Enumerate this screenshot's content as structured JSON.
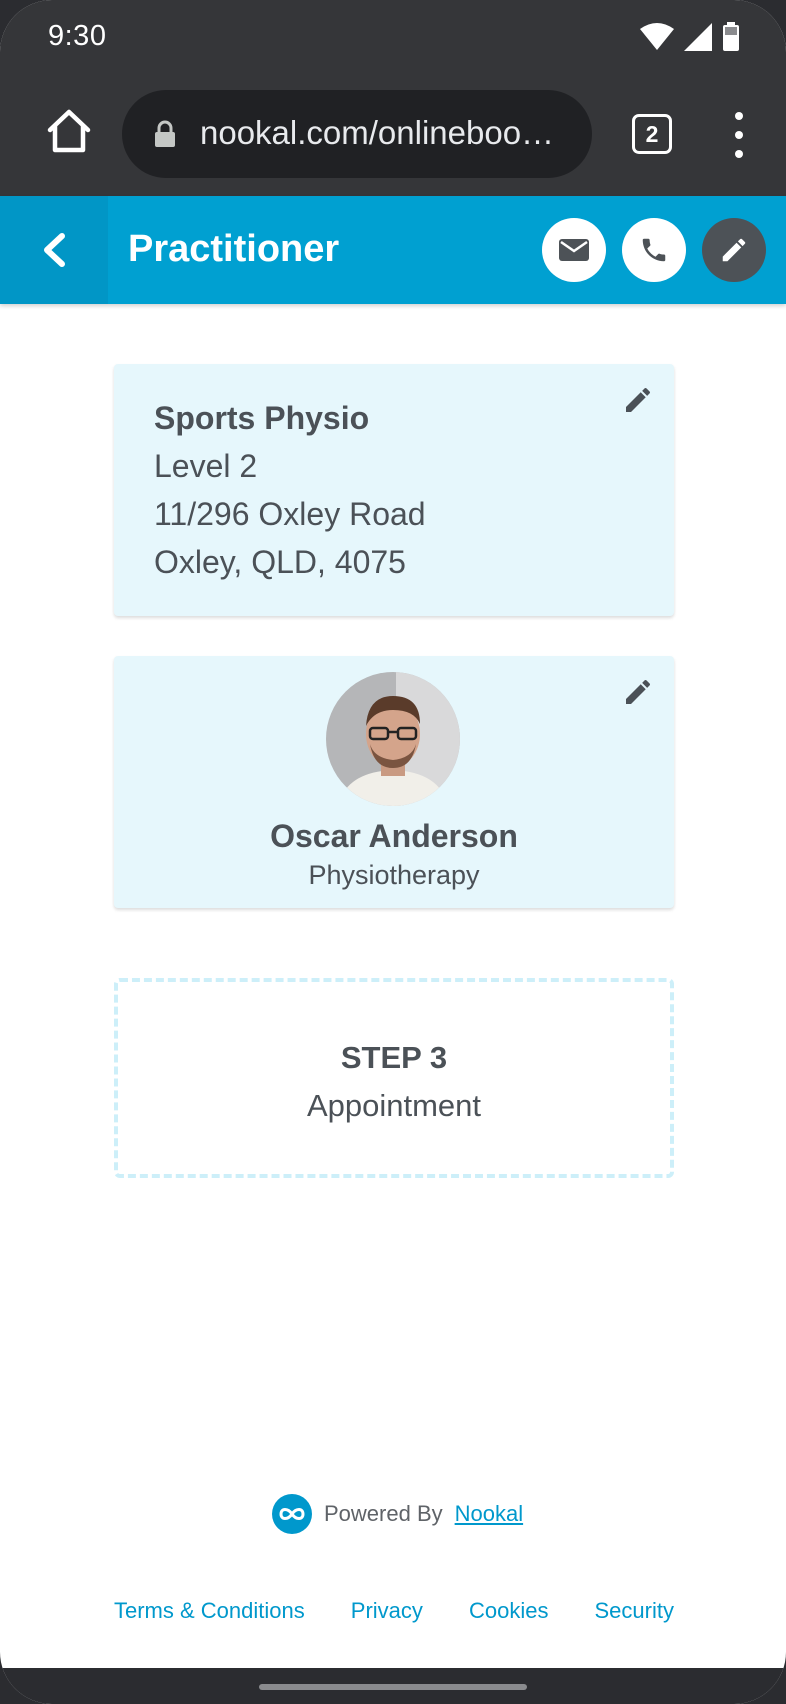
{
  "status_bar": {
    "time": "9:30"
  },
  "browser": {
    "url": "nookal.com/onlineboo…",
    "tab_count": "2"
  },
  "header": {
    "title": "Practitioner"
  },
  "location": {
    "name": "Sports Physio",
    "line1": "Level 2",
    "line2": "11/296 Oxley Road",
    "line3": "Oxley, QLD, 4075"
  },
  "practitioner": {
    "name": "Oscar Anderson",
    "specialty": "Physiotherapy"
  },
  "step": {
    "title": "STEP 3",
    "subtitle": "Appointment"
  },
  "footer": {
    "powered_prefix": "Powered By",
    "powered_link": "Nookal",
    "links": [
      "Terms & Conditions",
      "Privacy",
      "Cookies",
      "Security"
    ]
  },
  "colors": {
    "brand": "#00a0d1",
    "card_bg": "#e6f7fc",
    "text": "#4b5157",
    "link": "#0098cc"
  }
}
